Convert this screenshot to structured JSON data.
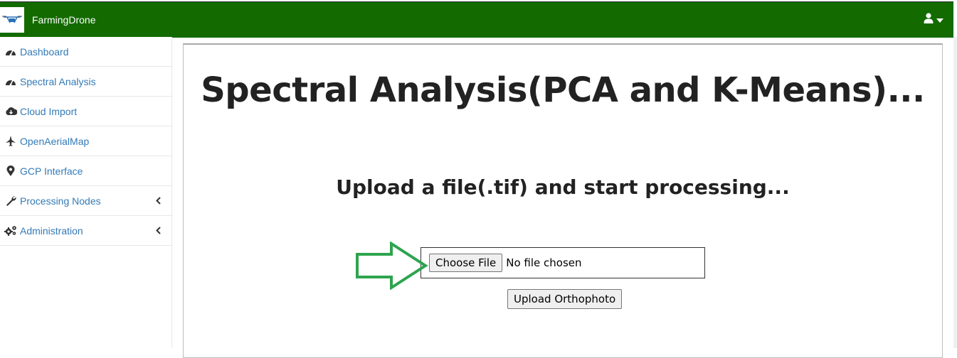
{
  "app": {
    "brand": "FarmingDrone"
  },
  "icons": {
    "logo": "drone-logo-icon",
    "user": "user-icon",
    "caret": "caret-down-icon"
  },
  "colors": {
    "topbar": "#136b00",
    "link": "#337ab7",
    "arrow": "#2ea44f"
  },
  "sidebar": {
    "items": [
      {
        "label": "Dashboard",
        "icon": "tachometer-icon"
      },
      {
        "label": "Spectral Analysis",
        "icon": "tachometer-icon"
      },
      {
        "label": "Cloud Import",
        "icon": "cloud-download-icon"
      },
      {
        "label": "OpenAerialMap",
        "icon": "plane-icon"
      },
      {
        "label": "GCP Interface",
        "icon": "map-marker-icon"
      },
      {
        "label": "Processing Nodes",
        "icon": "wrench-icon",
        "expandable": true
      },
      {
        "label": "Administration",
        "icon": "cogs-icon",
        "expandable": true
      }
    ]
  },
  "main": {
    "title": "Spectral Analysis(PCA and K-Means)...",
    "subtitle": "Upload a file(.tif) and start processing...",
    "file_input": {
      "button_label": "Choose File",
      "status": "No file chosen"
    },
    "upload_button": "Upload Orthophoto"
  }
}
